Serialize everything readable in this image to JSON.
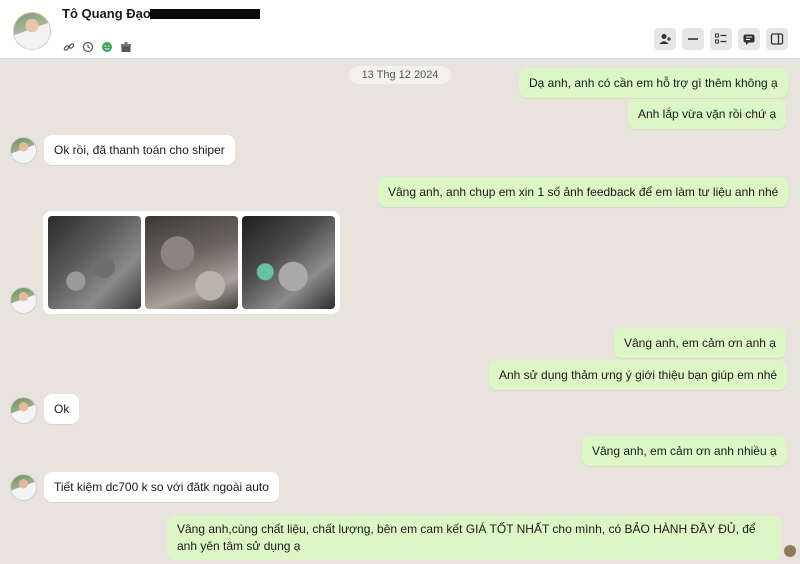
{
  "header": {
    "contact_name": "Tô Quang Đạo",
    "icons": [
      "link-icon",
      "history-icon",
      "face-icon",
      "store-icon"
    ],
    "tools": [
      "add-member-icon",
      "minimize-icon",
      "list-icon",
      "chat-icon",
      "sidebar-icon"
    ]
  },
  "chat": {
    "date_label": "13 Thg 12 2024",
    "messages": [
      {
        "from": "me",
        "text": "Dạ anh, anh có cần em hỗ trợ gì thêm không ạ"
      },
      {
        "from": "me",
        "text": "Anh lắp vừa vặn rồi chứ ạ"
      },
      {
        "from": "contact",
        "text": "Ok rồi, đã thanh toán cho shiper"
      },
      {
        "from": "me",
        "text": "Vâng anh, anh chụp em xin 1 số ảnh feedback để em làm tư liệu anh nhé"
      },
      {
        "from": "contact",
        "type": "photos",
        "count": 3
      },
      {
        "from": "me",
        "text": "Vâng anh, em cảm ơn anh ạ"
      },
      {
        "from": "me",
        "text": "Anh sử dụng thảm ưng ý giới thiệu bạn giúp em nhé"
      },
      {
        "from": "contact",
        "text": "Ok"
      },
      {
        "from": "me",
        "text": "Vâng anh, em cảm ơn anh nhiều ạ"
      },
      {
        "from": "contact",
        "text": "Tiết kiệm dc700 k so với đătk ngoài auto"
      },
      {
        "from": "me",
        "text": "Vâng anh,cùng chất liệu, chất lượng, bên em cam kết GIÁ TỐT NHẤT cho mình, có BẢO HÀNH ĐẦY ĐỦ, để anh yên tâm sử dụng ạ"
      }
    ]
  },
  "colors": {
    "outgoing_bubble": "#dcf6c5",
    "incoming_bubble": "#ffffff",
    "chat_background": "#e8e3dc"
  }
}
